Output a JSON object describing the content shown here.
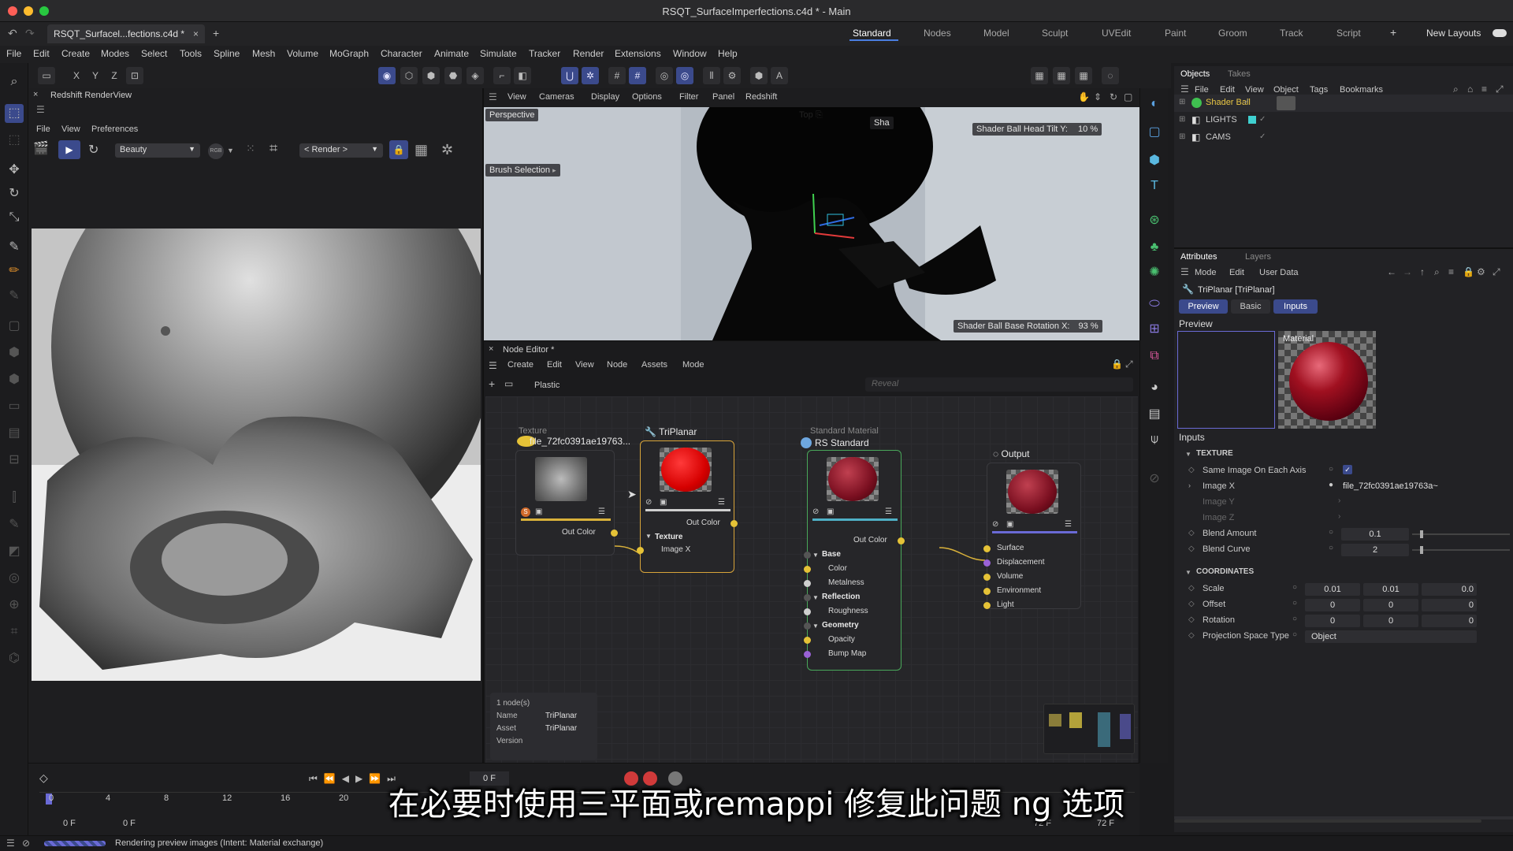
{
  "window": {
    "title": "RSQT_SurfaceImperfections.c4d * - Main"
  },
  "tabs": {
    "doc_tab": "RSQT_Surfacel...fections.c4d *",
    "close": "×",
    "add": "+"
  },
  "layouts": {
    "items": [
      "Standard",
      "Nodes",
      "Model",
      "Sculpt",
      "UVEdit",
      "Paint",
      "Groom",
      "Track",
      "Script"
    ],
    "add": "+",
    "new_layouts": "New Layouts"
  },
  "menubar": [
    "File",
    "Edit",
    "Create",
    "Modes",
    "Select",
    "Tools",
    "Spline",
    "Mesh",
    "Volume",
    "MoGraph",
    "Character",
    "Animate",
    "Simulate",
    "Tracker",
    "Render",
    "Extensions",
    "Window",
    "Help"
  ],
  "axis_buttons": [
    "X",
    "Y",
    "Z"
  ],
  "renderview": {
    "title": "Redshift RenderView",
    "menu": [
      "File",
      "View",
      "Preferences"
    ],
    "aov": "Beauty",
    "rgb": "RGB",
    "render_dropdown": "< Render >"
  },
  "viewport": {
    "menu": [
      "View",
      "Cameras",
      "Display",
      "Options",
      "Filter",
      "Panel",
      "Redshift"
    ],
    "perspective": "Perspective",
    "top_label": "Top",
    "brush": "Brush Selection",
    "hud_top": "Shader Ball Head Tilt Y:",
    "hud_top_value": "10 %",
    "hud_top_partial": "Sha",
    "hud_bottom": "Shader Ball Base Rotation X:",
    "hud_bottom_value": "93 %"
  },
  "node_editor": {
    "title": "Node Editor *",
    "menu": [
      "Create",
      "Edit",
      "View",
      "Node",
      "Assets",
      "Mode"
    ],
    "material": "Plastic",
    "reveal_placeholder": "Reveal",
    "nodes": {
      "texture": {
        "type_label": "Texture",
        "name": "file_72fc0391ae19763...",
        "out": "Out Color"
      },
      "triplanar": {
        "name": "TriPlanar",
        "out": "Out Color",
        "group": "Texture",
        "input": "Image X"
      },
      "standard": {
        "type_label": "Standard Material",
        "name": "RS Standard",
        "out": "Out Color",
        "inputs": [
          {
            "label": "Base",
            "group": true
          },
          {
            "label": "Color",
            "group": false
          },
          {
            "label": "Metalness",
            "group": false
          },
          {
            "label": "Reflection",
            "group": true
          },
          {
            "label": "Roughness",
            "group": false
          },
          {
            "label": "Geometry",
            "group": true
          },
          {
            "label": "Opacity",
            "group": false
          },
          {
            "label": "Bump Map",
            "group": false
          }
        ]
      },
      "output": {
        "name": "Output",
        "inputs": [
          "Surface",
          "Displacement",
          "Volume",
          "Environment",
          "Light"
        ]
      }
    },
    "info": {
      "count": "1 node(s)",
      "name_label": "Name",
      "name_value": "TriPlanar",
      "asset_label": "Asset",
      "asset_value": "TriPlanar",
      "version_label": "Version"
    }
  },
  "objects_panel": {
    "tabs": [
      "Objects",
      "Takes"
    ],
    "menu": [
      "File",
      "Edit",
      "View",
      "Object",
      "Tags",
      "Bookmarks"
    ],
    "items": [
      {
        "name": "Shader Ball",
        "color": "#e8c645"
      },
      {
        "name": "LIGHTS",
        "color": "#c9c9c9"
      },
      {
        "name": "CAMS",
        "color": "#c9c9c9"
      }
    ]
  },
  "attributes_panel": {
    "tabs": [
      "Attributes",
      "Layers"
    ],
    "menu": [
      "Mode",
      "Edit",
      "User Data"
    ],
    "object": "TriPlanar [TriPlanar]",
    "subtabs": [
      "Preview",
      "Basic",
      "Inputs"
    ],
    "preview_label": "Preview",
    "material_label": "Material",
    "inputs_label": "Inputs",
    "texture_section": "TEXTURE",
    "texture_rows": [
      {
        "label": "Same Image On Each Axis",
        "value": "✓"
      },
      {
        "label": "Image X",
        "value": "file_72fc0391ae19763a~"
      },
      {
        "label": "Image Y",
        "value": ""
      },
      {
        "label": "Image Z",
        "value": ""
      },
      {
        "label": "Blend Amount",
        "value": "0.1"
      },
      {
        "label": "Blend Curve",
        "value": "2"
      }
    ],
    "coord_section": "COORDINATES",
    "coord_rows": [
      {
        "label": "Scale",
        "values": [
          "0.01",
          "0.01",
          "0.0"
        ]
      },
      {
        "label": "Offset",
        "values": [
          "0",
          "0",
          "0"
        ]
      },
      {
        "label": "Rotation",
        "values": [
          "0",
          "0",
          "0"
        ]
      }
    ],
    "projection_label": "Projection Space Type",
    "projection_value": "Object"
  },
  "timeline": {
    "ticks": [
      "0",
      "4",
      "8",
      "12",
      "16",
      "20"
    ],
    "current_frame": "0 F",
    "start": "0 F",
    "start2": "0 F",
    "end": "72 F",
    "end2": "72 F"
  },
  "status": {
    "text": "Rendering preview images (Intent: Material exchange)"
  },
  "subtitle": {
    "text": "在必要时使用三平面或remappi 修复此问题 ng 选项"
  },
  "colors": {
    "accent": "#3b4a8c",
    "node_selected": "#d9a53a",
    "node_green": "#49a85a",
    "port_yellow": "#e5c237",
    "port_purple": "#9a62d6"
  }
}
